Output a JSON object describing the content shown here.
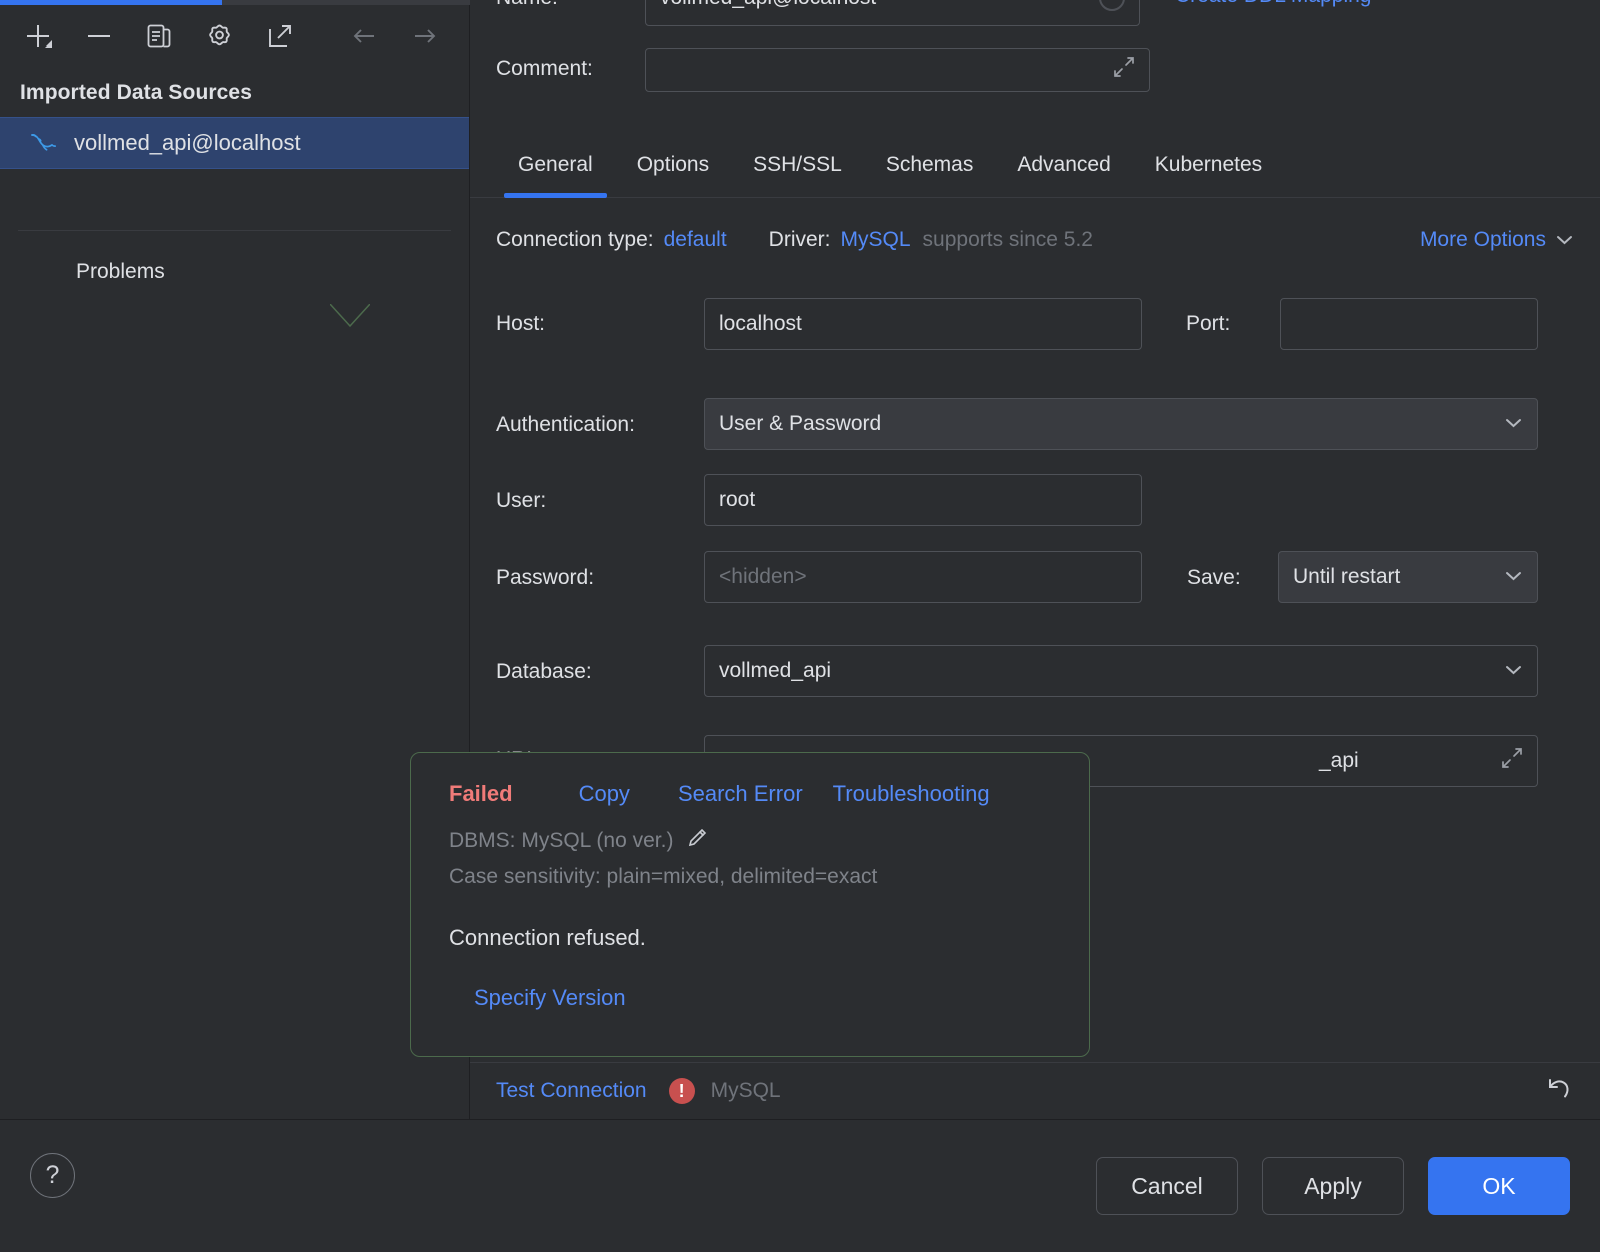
{
  "left_panel": {
    "toolbar": {
      "add": "add-icon",
      "remove": "remove-icon",
      "duplicate": "duplicate-icon",
      "settings": "gear-icon",
      "open_external": "open-external-icon",
      "back": "arrow-left-icon",
      "forward": "arrow-right-icon"
    },
    "section_title": "Imported Data Sources",
    "data_source": {
      "label": "vollmed_api@localhost",
      "icon": "mysql-dolphin-icon"
    },
    "problems_label": "Problems"
  },
  "form": {
    "name_label": "Name:",
    "name_value": "vollmed_api@localhost",
    "ddl_link": "Create DDL Mapping",
    "comment_label": "Comment:",
    "comment_value": "",
    "comment_placeholder": "",
    "tabs": [
      {
        "label": "General",
        "active": true
      },
      {
        "label": "Options",
        "active": false
      },
      {
        "label": "SSH/SSL",
        "active": false
      },
      {
        "label": "Schemas",
        "active": false
      },
      {
        "label": "Advanced",
        "active": false
      },
      {
        "label": "Kubernetes",
        "active": false
      }
    ],
    "connection_type_label": "Connection type:",
    "connection_type_value": "default",
    "driver_label": "Driver:",
    "driver_value": "MySQL",
    "driver_note": "supports since 5.2",
    "more_options": "More Options",
    "host_label": "Host:",
    "host_value": "localhost",
    "port_label": "Port:",
    "port_value": "",
    "authentication_label": "Authentication:",
    "authentication_value": "User & Password",
    "user_label": "User:",
    "user_value": "root",
    "password_label": "Password:",
    "password_placeholder": "<hidden>",
    "save_label": "Save:",
    "save_value": "Until restart",
    "database_label": "Database:",
    "database_value": "vollmed_api",
    "url_label": "URL:",
    "url_value": "_api"
  },
  "test_strip": {
    "test_connection": "Test Connection",
    "error_icon": "error-exclamation-icon",
    "dbms": "MySQL",
    "revert_icon": "revert-icon"
  },
  "popup": {
    "status": "Failed",
    "copy": "Copy",
    "search_error": "Search Error",
    "troubleshooting": "Troubleshooting",
    "dbms_line": "DBMS: MySQL (no ver.)",
    "edit_icon": "pencil-icon",
    "case_sensitivity_line": "Case sensitivity: plain=mixed, delimited=exact",
    "message": "Connection refused.",
    "specify_version": "Specify Version"
  },
  "bottom_bar": {
    "help": "?",
    "cancel": "Cancel",
    "apply": "Apply",
    "ok": "OK"
  },
  "colors": {
    "accent": "#3574f0",
    "link": "#548af7",
    "error": "#f07b79",
    "error_badge": "#c8504f",
    "popup_border": "#4c6a4c",
    "selection": "#2e436e",
    "background": "#2b2d30"
  }
}
